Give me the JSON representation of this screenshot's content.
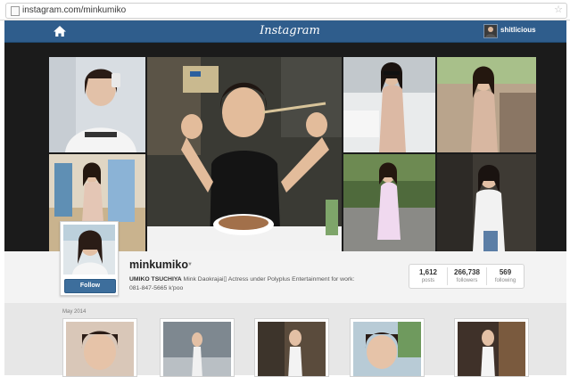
{
  "browser": {
    "url": "instagram.com/minkumiko",
    "page_icon": "page-icon",
    "bookmark_icon": "star-icon"
  },
  "header": {
    "home_icon": "home-icon",
    "brand": "Instagram",
    "user": "shitlicious"
  },
  "profile": {
    "username": "minkumiko",
    "follow_label": "Follow",
    "bio_name": "UMIKO TSUCHIYA",
    "bio_text": " Mink Daokrajai▯ Actress under Polyplus Entertainment     for work:",
    "bio_line2": "081-847-5665 k'poo",
    "stats": [
      {
        "value": "1,612",
        "label": "posts"
      },
      {
        "value": "266,738",
        "label": "followers"
      },
      {
        "value": "569",
        "label": "following"
      }
    ]
  },
  "grid": {
    "month_label": "May 2014",
    "thumbs": [
      "post-thumbnail-1",
      "post-thumbnail-2",
      "post-thumbnail-3",
      "post-thumbnail-4",
      "post-thumbnail-5"
    ]
  },
  "colors": {
    "header_blue": "#2f5d8c",
    "follow_blue": "#3d6e9c",
    "dark_band": "#1b1b1b"
  }
}
